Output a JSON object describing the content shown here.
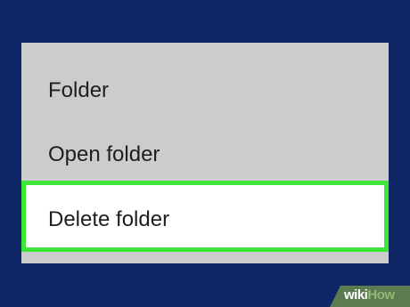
{
  "background_color": "#0f2766",
  "menu": {
    "title": "Folder",
    "items": [
      {
        "label": "Open folder",
        "highlighted": false
      },
      {
        "label": "Delete folder",
        "highlighted": true
      }
    ],
    "panel_color": "#cccccc",
    "highlight_color": "#3ee63a"
  },
  "watermark": {
    "wiki": "wiki",
    "how": "How"
  }
}
